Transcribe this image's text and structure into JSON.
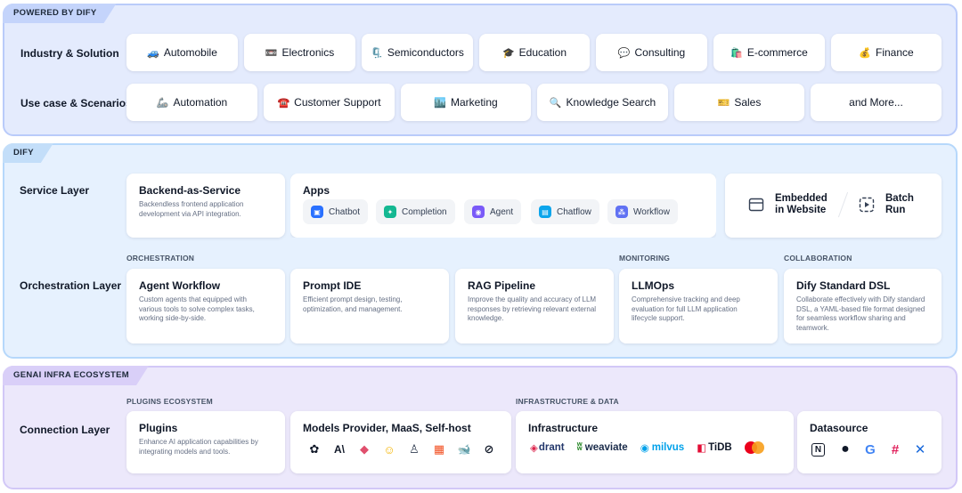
{
  "powered": {
    "tag": "POWERED BY DIFY",
    "industry_label": "Industry & Solution",
    "industries": [
      {
        "emoji": "🚙",
        "label": "Automobile"
      },
      {
        "emoji": "📼",
        "label": "Electronics"
      },
      {
        "emoji": "🗜️",
        "label": "Semiconductors"
      },
      {
        "emoji": "🎓",
        "label": "Education"
      },
      {
        "emoji": "💬",
        "label": "Consulting"
      },
      {
        "emoji": "🛍️",
        "label": "E-commerce"
      },
      {
        "emoji": "💰",
        "label": "Finance"
      }
    ],
    "usecase_label": "Use case & Scenarios",
    "usecases": [
      {
        "emoji": "🦾",
        "label": "Automation"
      },
      {
        "emoji": "☎️",
        "label": "Customer Support"
      },
      {
        "emoji": "🏙️",
        "label": "Marketing"
      },
      {
        "emoji": "🔍",
        "label": "Knowledge Search"
      },
      {
        "emoji": "🎫",
        "label": "Sales"
      },
      {
        "emoji": "",
        "label": "and More..."
      }
    ]
  },
  "dify": {
    "tag": "DIFY",
    "service_label": "Service Layer",
    "baas": {
      "title": "Backend-as-Service",
      "desc": "Backendless frontend application development via API integration."
    },
    "apps": {
      "title": "Apps",
      "items": [
        {
          "label": "Chatbot",
          "icon": "chatbot-icon",
          "color": "#2970ff",
          "glyph": "▣"
        },
        {
          "label": "Completion",
          "icon": "completion-icon",
          "color": "#14b892",
          "glyph": "✦"
        },
        {
          "label": "Agent",
          "icon": "agent-icon",
          "color": "#7a5af8",
          "glyph": "◉"
        },
        {
          "label": "Chatflow",
          "icon": "chatflow-icon",
          "color": "#0ba5ec",
          "glyph": "▤"
        },
        {
          "label": "Workflow",
          "icon": "workflow-icon",
          "color": "#6172f3",
          "glyph": "⁂"
        }
      ]
    },
    "embedded": {
      "line1": "Embedded",
      "line2": "in Website"
    },
    "batch": {
      "line1": "Batch",
      "line2": "Run"
    },
    "orchestration_label": "Orchestration Layer",
    "sub_orchestration": "ORCHESTRATION",
    "sub_monitoring": "MONITORING",
    "sub_collaboration": "COLLABORATION",
    "orchestration_cards": [
      {
        "title": "Agent Workflow",
        "desc": "Custom agents that equipped with various tools to solve complex tasks, working side-by-side."
      },
      {
        "title": "Prompt IDE",
        "desc": "Efficient prompt design, testing, optimization, and management."
      },
      {
        "title": "RAG Pipeline",
        "desc": "Improve the quality and accuracy of LLM responses by retrieving relevant external knowledge."
      },
      {
        "title": "LLMOps",
        "desc": "Comprehensive tracking and deep evaluation for full LLM application lifecycle support."
      },
      {
        "title": "Dify Standard DSL",
        "desc": "Collaborate effectively with Dify standard DSL, a YAML-based file format designed for seamless workflow sharing and teamwork."
      }
    ]
  },
  "genai": {
    "tag": "GENAI INFRA ECOSYSTEM",
    "connection_label": "Connection Layer",
    "sub_plugins": "PLUGINS ECOSYSTEM",
    "sub_infra": "INFRASTRUCTURE & DATA",
    "plugins": {
      "title": "Plugins",
      "desc": "Enhance AI application capabilities by integrating models and tools."
    },
    "models": {
      "title": "Models Provider, MaaS, Self-host",
      "logos": [
        {
          "name": "openai-icon",
          "glyph": "✿",
          "color": "#101828"
        },
        {
          "name": "anthropic-icon",
          "glyph": "A\\",
          "color": "#101828"
        },
        {
          "name": "gemini-icon",
          "glyph": "◆",
          "color": "#e04f6d"
        },
        {
          "name": "huggingface-icon",
          "glyph": "☺",
          "color": "#f5b400"
        },
        {
          "name": "ollama-icon",
          "glyph": "♙",
          "color": "#344054"
        },
        {
          "name": "microsoft-icon",
          "glyph": "▦",
          "color": "#f25022"
        },
        {
          "name": "deepseek-icon",
          "glyph": "🐋",
          "color": "#4d6bfe"
        },
        {
          "name": "zhipu-icon",
          "glyph": "⊘",
          "color": "#101828"
        }
      ]
    },
    "infrastructure": {
      "title": "Infrastructure",
      "logos": [
        {
          "name": "qdrant-logo",
          "text": "drant",
          "mark": "◈",
          "color": "#dc244c"
        },
        {
          "name": "weaviate-logo",
          "text": "weaviate",
          "mark": "ʬ",
          "color": "#2e8b2e"
        },
        {
          "name": "milvus-logo",
          "text": "milvus",
          "mark": "◉",
          "color": "#00a1ea"
        },
        {
          "name": "tidb-logo",
          "text": "TiDB",
          "mark": "◧",
          "color": "#e30c34"
        },
        {
          "name": "mastercard-logo",
          "text": "",
          "mark": "●",
          "color": "#eb001b"
        }
      ]
    },
    "datasource": {
      "title": "Datasource",
      "logos": [
        {
          "name": "notion-icon",
          "glyph": "N",
          "color": "#101828"
        },
        {
          "name": "github-icon",
          "glyph": "●",
          "color": "#101828"
        },
        {
          "name": "google-icon",
          "glyph": "G",
          "color": "#4285f4"
        },
        {
          "name": "slack-icon",
          "glyph": "#",
          "color": "#e01e5a"
        },
        {
          "name": "confluence-icon",
          "glyph": "✕",
          "color": "#1868db"
        }
      ]
    }
  }
}
